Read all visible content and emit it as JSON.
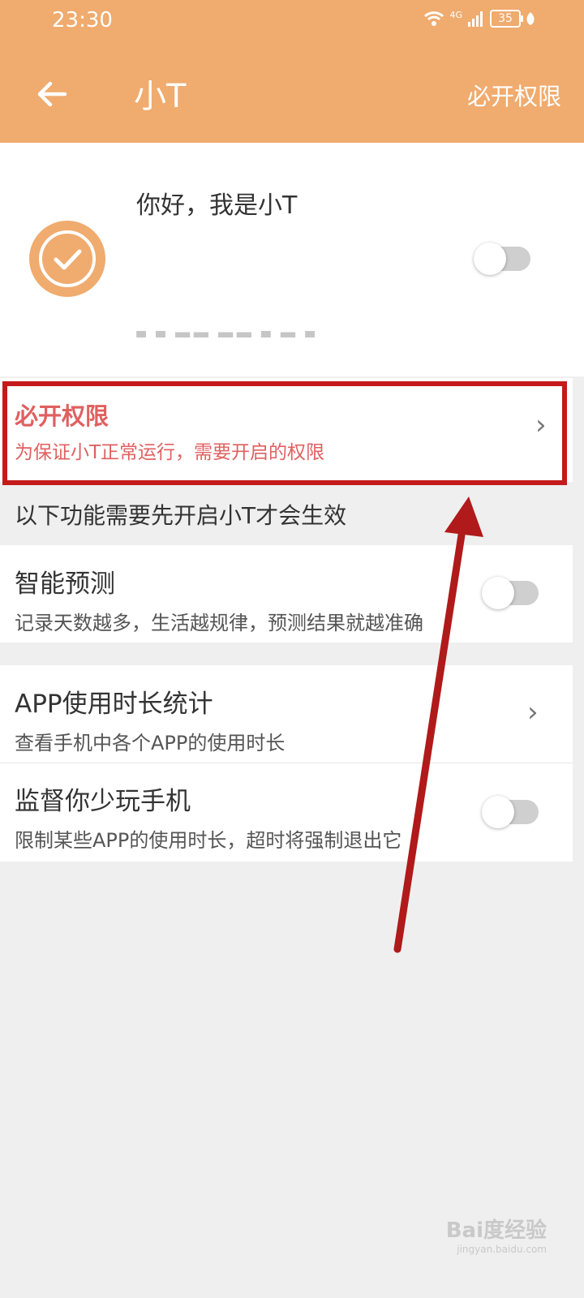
{
  "status": {
    "time": "23:30",
    "network": "4G",
    "battery": "35"
  },
  "appbar": {
    "title": "小T",
    "right_action": "必开权限"
  },
  "hero": {
    "greeting": "你好，我是小T",
    "toggle_on": false
  },
  "permission": {
    "title": "必开权限",
    "subtitle": "为保证小T正常运行，需要开启的权限"
  },
  "section_header": "以下功能需要先开启小T才会生效",
  "features": [
    {
      "title": "智能预测",
      "subtitle": "记录天数越多，生活越规律，预测结果就越准确",
      "toggle_on": false
    },
    {
      "title": "APP使用时长统计",
      "subtitle": "查看手机中各个APP的使用时长"
    },
    {
      "title": "监督你少玩手机",
      "subtitle": "限制某些APP的使用时长，超时将强制退出它",
      "toggle_on": false
    }
  ],
  "watermark": {
    "brand": "Bai度经验",
    "url": "jingyan.baidu.com"
  },
  "colors": {
    "header": "#f0ab6e",
    "highlight_border": "#c41a1a",
    "permission_text": "#e06060",
    "arrow": "#b01a1a"
  }
}
